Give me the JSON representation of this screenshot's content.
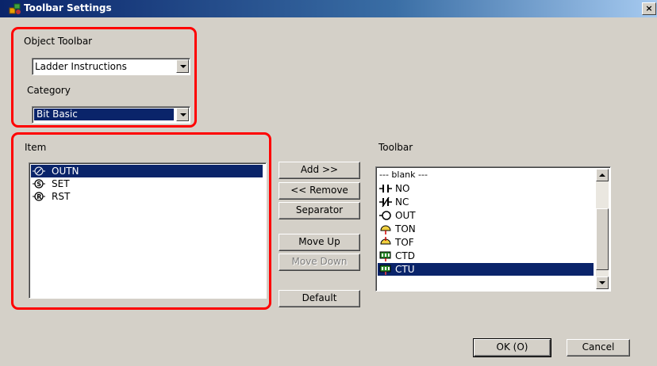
{
  "window": {
    "title": "Toolbar Settings",
    "close_label": "×"
  },
  "object_toolbar": {
    "label": "Object Toolbar",
    "value": "Ladder Instructions"
  },
  "category": {
    "label": "Category",
    "value": "Bit Basic"
  },
  "item": {
    "label": "Item",
    "items": [
      {
        "label": "OUTN",
        "icon": "outn-coil-icon",
        "selected": true
      },
      {
        "label": "SET",
        "icon": "set-coil-icon",
        "selected": false
      },
      {
        "label": "RST",
        "icon": "rst-coil-icon",
        "selected": false
      }
    ]
  },
  "buttons": {
    "add": "Add >>",
    "remove": "<< Remove",
    "separator": "Separator",
    "move_up": "Move Up",
    "move_down": "Move Down",
    "default": "Default",
    "ok": "OK (O)",
    "cancel": "Cancel"
  },
  "toolbar": {
    "label": "Toolbar",
    "items": [
      {
        "label": "--- blank ---",
        "icon": "",
        "selected": false
      },
      {
        "label": "NO",
        "icon": "no-contact-icon",
        "selected": false
      },
      {
        "label": "NC",
        "icon": "nc-contact-icon",
        "selected": false
      },
      {
        "label": "OUT",
        "icon": "out-coil-icon",
        "selected": false
      },
      {
        "label": "TON",
        "icon": "ton-timer-icon",
        "selected": false
      },
      {
        "label": "TOF",
        "icon": "tof-timer-icon",
        "selected": false
      },
      {
        "label": "CTD",
        "icon": "ctd-counter-icon",
        "selected": false
      },
      {
        "label": "CTU",
        "icon": "ctu-counter-icon",
        "selected": true
      }
    ]
  },
  "colors": {
    "highlight": "#0a246a",
    "annotation": "#ff0000",
    "dialog": "#d4d0c8"
  }
}
